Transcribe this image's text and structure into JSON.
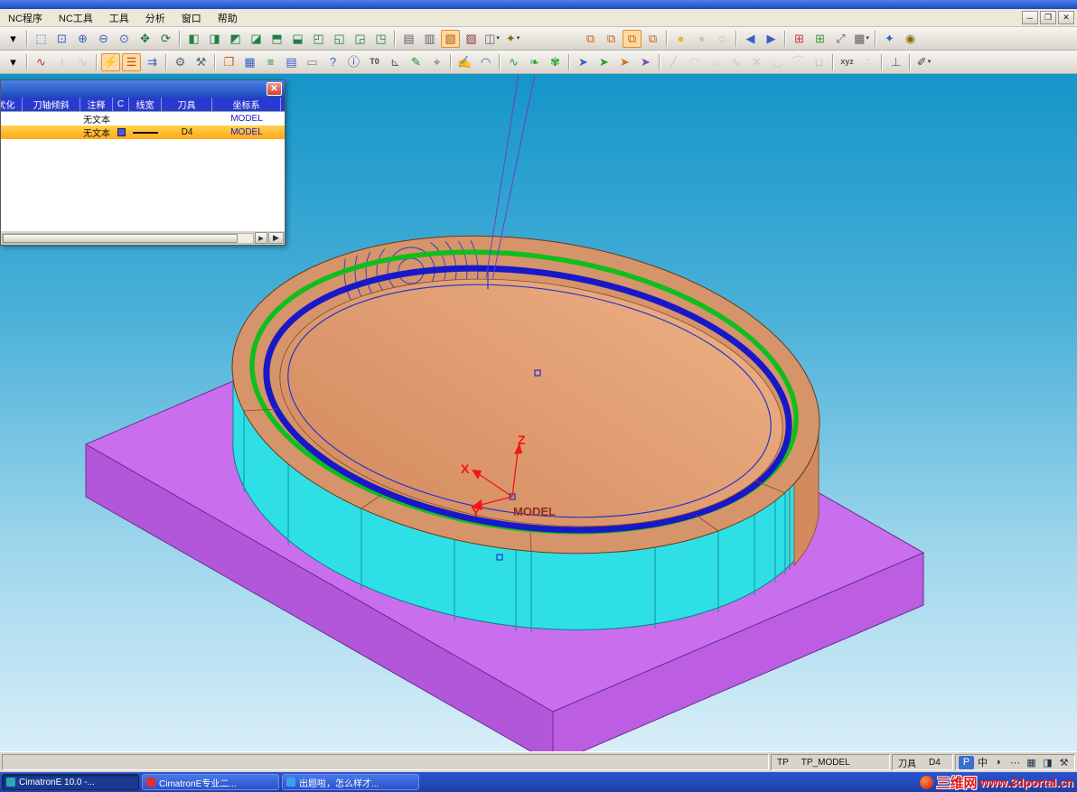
{
  "window": {
    "controls": {
      "minimize": "─",
      "maximize": "❐",
      "close": "✕"
    }
  },
  "menu": {
    "items": [
      "NC程序",
      "NC工具",
      "工具",
      "分析",
      "窗口",
      "帮助"
    ]
  },
  "toolbar1": {
    "left": [
      {
        "g": "▾",
        "n": "toolbar-overflow-button"
      },
      {
        "sep": true
      },
      {
        "g": "⬚",
        "n": "select-frame-icon",
        "fg": "#3a5fc8"
      },
      {
        "g": "⊡",
        "n": "zoom-window-icon",
        "fg": "#3a5fc8"
      },
      {
        "g": "⊕",
        "n": "zoom-in-icon",
        "fg": "#3a5fc8"
      },
      {
        "g": "⊖",
        "n": "zoom-out-icon",
        "fg": "#3a5fc8"
      },
      {
        "g": "⊙",
        "n": "zoom-all-icon",
        "fg": "#3a5fc8"
      },
      {
        "g": "✥",
        "n": "pan-icon",
        "fg": "#207040"
      },
      {
        "g": "⟳",
        "n": "rotate-view-icon",
        "fg": "#207040"
      },
      {
        "sep": true
      },
      {
        "g": "◧",
        "n": "view-front-icon",
        "fg": "#1d8040"
      },
      {
        "g": "◨",
        "n": "view-back-icon",
        "fg": "#1d8040"
      },
      {
        "g": "◩",
        "n": "view-left-icon",
        "fg": "#1d8040"
      },
      {
        "g": "◪",
        "n": "view-right-icon",
        "fg": "#1d8040"
      },
      {
        "g": "⬒",
        "n": "view-top-icon",
        "fg": "#1d8040"
      },
      {
        "g": "⬓",
        "n": "view-bottom-icon",
        "fg": "#1d8040"
      },
      {
        "g": "◰",
        "n": "view-iso-icon",
        "fg": "#1d8040"
      },
      {
        "g": "◱",
        "n": "view-axonometric-icon",
        "fg": "#1d8040"
      },
      {
        "g": "◲",
        "n": "view-dimetric-icon",
        "fg": "#1d8040"
      },
      {
        "g": "◳",
        "n": "view-custom-icon",
        "fg": "#1d8040"
      },
      {
        "sep": true
      },
      {
        "g": "▤",
        "n": "wireframe-display-icon",
        "fg": "#606060"
      },
      {
        "g": "▥",
        "n": "hidden-line-display-icon",
        "fg": "#606060"
      },
      {
        "g": "▧",
        "n": "shaded-display-icon",
        "fg": "#b05a10",
        "pressed": true
      },
      {
        "g": "▨",
        "n": "transparent-display-icon",
        "fg": "#8a3a3a"
      },
      {
        "g": "◫",
        "n": "display-options-icon",
        "fg": "#606060",
        "drop": true
      },
      {
        "g": "✦",
        "n": "render-options-icon",
        "fg": "#8a6a10",
        "drop": true
      }
    ],
    "right": [
      {
        "g": "⧉",
        "n": "nc-window-layout-1-icon",
        "fg": "#d06010"
      },
      {
        "g": "⧉",
        "n": "nc-window-layout-2-icon",
        "fg": "#d06010"
      },
      {
        "g": "⧉",
        "n": "nc-window-layout-3-icon",
        "fg": "#d06010",
        "pressed": true
      },
      {
        "g": "⧉",
        "n": "nc-window-layout-4-icon",
        "fg": "#d06010"
      },
      {
        "sep": true
      },
      {
        "g": "●",
        "n": "light-on-icon",
        "fg": "#e8b818"
      },
      {
        "g": "●",
        "n": "light-dim-icon",
        "fg": "#c8c8b0"
      },
      {
        "g": "◌",
        "n": "light-off-icon",
        "fg": "#9a9a8a"
      },
      {
        "sep": true
      },
      {
        "g": "◀",
        "n": "step-back-icon",
        "fg": "#3a5fc8"
      },
      {
        "g": "▶",
        "n": "step-forward-icon",
        "fg": "#3a5fc8"
      },
      {
        "sep": true
      },
      {
        "g": "⊞",
        "n": "split-view-red-icon",
        "fg": "#c83a3a"
      },
      {
        "g": "⊞",
        "n": "split-view-green-icon",
        "fg": "#3a9a3a"
      },
      {
        "g": "⤢",
        "n": "expand-view-icon",
        "fg": "#606060"
      },
      {
        "g": "▦",
        "n": "grid-options-icon",
        "fg": "#606060",
        "drop": true
      },
      {
        "sep": true
      },
      {
        "g": "✦",
        "n": "favorites-icon",
        "fg": "#3a5fc8"
      },
      {
        "g": "◉",
        "n": "target-point-icon",
        "fg": "#8a6a10"
      }
    ]
  },
  "toolbar2": {
    "items": [
      {
        "g": "▾",
        "n": "toolbar2-overflow-button"
      },
      {
        "sep": true
      },
      {
        "g": "∿",
        "n": "nc-procedure-icon",
        "fg": "#c82838"
      },
      {
        "g": "≀",
        "n": "nc-connect-icon",
        "fg": "#b0a8a0",
        "disabled": true
      },
      {
        "g": "∿",
        "n": "nc-curves-icon",
        "fg": "#b0a8a0",
        "disabled": true
      },
      {
        "sep": true
      },
      {
        "g": "⚡",
        "n": "optimizer-icon",
        "fg": "#b05a10",
        "pressed": true
      },
      {
        "g": "☰",
        "n": "process-manager-icon",
        "fg": "#b05a10",
        "pressed": true
      },
      {
        "g": "⇉",
        "n": "batch-run-icon",
        "fg": "#3a5fc8"
      },
      {
        "sep": true
      },
      {
        "g": "⚙",
        "n": "machine-settings-icon",
        "fg": "#556677"
      },
      {
        "g": "⚒",
        "n": "tool-manager-icon",
        "fg": "#556677"
      },
      {
        "sep": true
      },
      {
        "g": "❐",
        "n": "template-window-icon",
        "fg": "#d06010"
      },
      {
        "g": "▦",
        "n": "table-view-icon",
        "fg": "#3a5fc8"
      },
      {
        "g": "≡",
        "n": "report-icon",
        "fg": "#2a8a2a"
      },
      {
        "g": "▤",
        "n": "list-view-icon",
        "fg": "#3a5fc8"
      },
      {
        "g": "▭",
        "n": "preview-icon",
        "fg": "#8a8a7a"
      },
      {
        "g": "?",
        "n": "query-icon",
        "fg": "#3a5fc8"
      },
      {
        "g": "ⓘ",
        "n": "info-icon",
        "fg": "#2a4a9a"
      },
      {
        "g": "T0",
        "n": "tool-origin-icon",
        "fg": "#444444",
        "text": true
      },
      {
        "g": "⊾",
        "n": "angle-measure-icon",
        "fg": "#666666"
      },
      {
        "g": "✎",
        "n": "annotate-icon",
        "fg": "#2a8a2a"
      },
      {
        "g": "⌖",
        "n": "locate-icon",
        "fg": "#666666"
      },
      {
        "sep": true
      },
      {
        "g": "✍",
        "n": "sketcher-icon",
        "fg": "#3a5fc8"
      },
      {
        "g": "◠",
        "n": "arc-tool-icon",
        "fg": "#3a5fc8"
      },
      {
        "sep": true
      },
      {
        "g": "∿",
        "n": "spline-tool-icon",
        "fg": "#2aa22a"
      },
      {
        "g": "❧",
        "n": "curve-tool-icon",
        "fg": "#2aa22a"
      },
      {
        "g": "✾",
        "n": "surface-tool-icon",
        "fg": "#2aa22a"
      },
      {
        "sep": true
      },
      {
        "g": "➤",
        "n": "pick-entity-icon",
        "fg": "#3a5fc8"
      },
      {
        "g": "➤",
        "n": "pick-face-icon",
        "fg": "#2aa22a"
      },
      {
        "g": "➤",
        "n": "pick-edge-icon",
        "fg": "#c87818"
      },
      {
        "g": "➤",
        "n": "pick-point-icon",
        "fg": "#8a48a8"
      },
      {
        "sep": true
      },
      {
        "g": "╱",
        "n": "line-draw-icon",
        "fg": "#b0a8a0",
        "disabled": true
      },
      {
        "g": "◠",
        "n": "arc-draw-icon",
        "fg": "#b0a8a0",
        "disabled": true
      },
      {
        "g": "○",
        "n": "circle-draw-icon",
        "fg": "#b0a8a0",
        "disabled": true
      },
      {
        "g": "∿",
        "n": "spline-draw-icon",
        "fg": "#b0a8a0",
        "disabled": true
      },
      {
        "g": "✕",
        "n": "point-draw-icon",
        "fg": "#b0a8a0",
        "disabled": true
      },
      {
        "g": "◡",
        "n": "fillet-draw-icon",
        "fg": "#b0a8a0",
        "disabled": true
      },
      {
        "g": "⌒",
        "n": "chamfer-draw-icon",
        "fg": "#b0a8a0",
        "disabled": true
      },
      {
        "g": "⊔",
        "n": "slot-draw-icon",
        "fg": "#b0a8a0",
        "disabled": true
      },
      {
        "sep": true
      },
      {
        "g": "xyz",
        "n": "xyz-readout-icon",
        "fg": "#555555",
        "text": true
      },
      {
        "g": "∴",
        "n": "points-display-icon",
        "fg": "#b0a8a0",
        "disabled": true
      },
      {
        "sep": true
      },
      {
        "g": "⊥",
        "n": "normal-direction-icon",
        "fg": "#8a48a8"
      },
      {
        "sep": true
      },
      {
        "g": "✐",
        "n": "pen-style-icon",
        "fg": "#444444",
        "drop": true
      }
    ]
  },
  "panel": {
    "title": "",
    "close_glyph": "✕",
    "columns": [
      "优化",
      "刀轴倾斜",
      "注释",
      "C",
      "线宽",
      "刀具",
      "坐标系"
    ],
    "rows": [
      {
        "comment": "无文本",
        "color": null,
        "line": false,
        "tool": "",
        "csys": "MODEL",
        "selected": false
      },
      {
        "comment": "无文本",
        "color": "#4a5ae8",
        "line": true,
        "tool": "D4",
        "csys": "MODEL",
        "selected": true
      }
    ],
    "scroll_right_glyph": "▶",
    "corner_glyph": "▶"
  },
  "viewport": {
    "axes": {
      "x": "X",
      "y": "Y",
      "z": "Z",
      "origin_label": "MODEL"
    },
    "colors": {
      "base": "#c96fee",
      "wall": "#2ee0e6",
      "top_ring": "#d6946a",
      "floor": "#e2a276",
      "toolpath_green": "#0fbe1e",
      "toolpath_blue": "#1818c8",
      "axis_red": "#f51515"
    }
  },
  "statusbar": {
    "csys_label": "TP",
    "csys_value": "TP_MODEL",
    "tool_label": "刀具",
    "tool_value": "D4",
    "ime_icons": [
      {
        "g": "P",
        "n": "ime-indicator-icon",
        "bg": "#3a6fd0",
        "fg": "#ffffff"
      },
      {
        "g": "中",
        "n": "ime-chinese-icon",
        "fg": "#222222"
      },
      {
        "g": "◗",
        "n": "ime-halfwidth-icon",
        "fg": "#223344"
      },
      {
        "g": "⋯",
        "n": "ime-punctuation-icon",
        "fg": "#223344"
      },
      {
        "g": "▦",
        "n": "soft-keyboard-icon",
        "fg": "#223344"
      },
      {
        "g": "◨",
        "n": "ime-band-icon",
        "fg": "#223344"
      },
      {
        "g": "⚒",
        "n": "ime-tools-icon",
        "fg": "#223344"
      }
    ]
  },
  "taskbar": {
    "tasks": [
      {
        "label": "CimatronE 10.0 -...",
        "active": true,
        "icon_color": "#2aa8b8"
      },
      {
        "label": "CimatronE专业二...",
        "active": false,
        "icon_color": "#e03030"
      },
      {
        "label": "出题啦，怎么样才...",
        "active": false,
        "icon_color": "#3aa0f0"
      }
    ],
    "watermark": {
      "site": "三维网",
      "url": "www.3dportal.cn"
    }
  }
}
